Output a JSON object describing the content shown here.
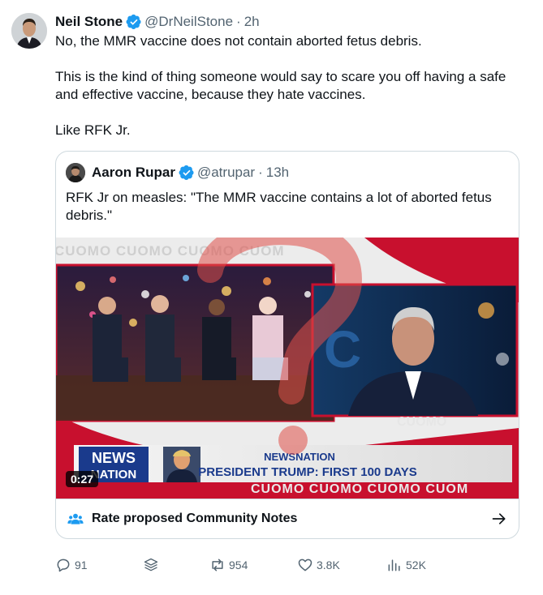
{
  "post": {
    "author_name": "Neil Stone",
    "handle": "@DrNeilStone",
    "separator": "·",
    "time": "2h",
    "paragraphs": [
      "No, the MMR vaccine does not contain aborted fetus debris.",
      "This is the kind of thing someone would say to scare you off having a safe and effective vaccine, because they hate vaccines.",
      "Like RFK Jr."
    ]
  },
  "quote": {
    "author_name": "Aaron Rupar",
    "handle": "@atrupar",
    "separator": "·",
    "time": "13h",
    "text": "RFK Jr on measles: \"The MMR vaccine contains a lot of aborted fetus debris.\"",
    "video": {
      "duration": "0:27",
      "watermark_text": "CUOMO",
      "ticker_text": "CUOMO  CUOMO  CUOMO  CUOM",
      "network_logo_top": "NEWS",
      "network_logo_bottom": "NATION",
      "lower_third_brand": "NEWSNATION",
      "lower_third_headline": "PRESIDENT TRUMP: FIRST 100 DAYS"
    },
    "community_notes_label": "Rate proposed Community Notes"
  },
  "actions": {
    "replies": "91",
    "reposts": "954",
    "likes": "3.8K",
    "views": "52K"
  },
  "colors": {
    "verified": "#1d9bf0",
    "text": "#0f1419",
    "secondary": "#536471",
    "border": "#cfd9de",
    "network_red": "#c8102e",
    "network_blue": "#1a3a8c"
  },
  "icons": [
    "verified-badge-icon",
    "community-notes-icon",
    "arrow-right-icon",
    "reply-icon",
    "bookmark-stack-icon",
    "repost-icon",
    "like-icon",
    "views-icon"
  ]
}
